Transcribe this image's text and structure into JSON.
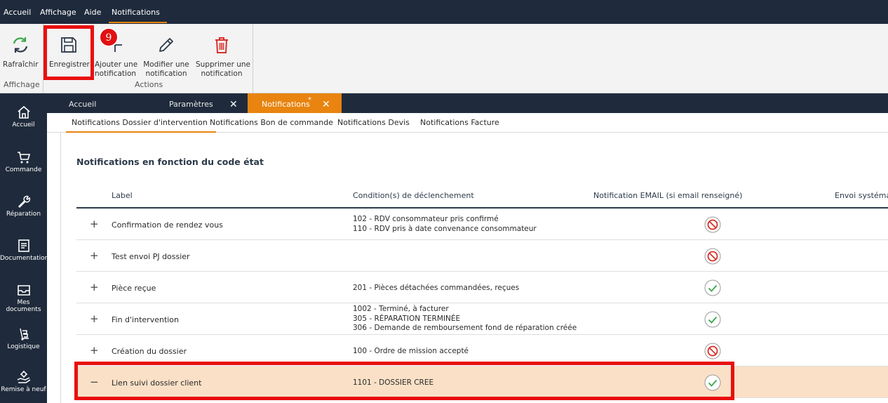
{
  "menu": {
    "items": [
      {
        "label": "Accueil"
      },
      {
        "label": "Affichage"
      },
      {
        "label": "Aide"
      },
      {
        "label": "Notifications"
      }
    ]
  },
  "ribbon": {
    "refresh": {
      "label": "Rafraîchir",
      "icon": "refresh-icon"
    },
    "save": {
      "label": "Enregistrer",
      "icon": "save-icon"
    },
    "add": {
      "line1": "Ajouter une",
      "line2": "notification",
      "icon": "plus-icon"
    },
    "edit": {
      "line1": "Modifier une",
      "line2": "notification",
      "icon": "pencil-icon"
    },
    "delete": {
      "line1": "Supprimer une",
      "line2": "notification",
      "icon": "trash-icon"
    },
    "groups": {
      "display": "Affichage",
      "actions": "Actions"
    },
    "step_badge": "9"
  },
  "sidebar": {
    "items": [
      {
        "label": "Accueil",
        "icon": "home-icon"
      },
      {
        "label": "Commande",
        "icon": "cart-icon"
      },
      {
        "label": "Réparation",
        "icon": "wrench-icon"
      },
      {
        "label": "Documentation",
        "icon": "document-icon"
      },
      {
        "label": "Mes documents",
        "icon": "inbox-icon"
      },
      {
        "label": "Logistique",
        "icon": "hand-truck-icon"
      },
      {
        "label": "Remise à neuf",
        "icon": "hand-gear-icon"
      }
    ]
  },
  "tabs": [
    {
      "label": "Accueil"
    },
    {
      "label": "Paramètres",
      "close": "✕"
    },
    {
      "label": "Notifications",
      "modified": "*",
      "close": "✕"
    }
  ],
  "subtabs": [
    {
      "label": "Notifications Dossier d'intervention"
    },
    {
      "label": "Notifications Bon de commande"
    },
    {
      "label": "Notifications Devis"
    },
    {
      "label": "Notifications Facture"
    }
  ],
  "content": {
    "title": "Notifications en fonction du code état",
    "columns": {
      "label": "Label",
      "conditions": "Condition(s) de déclenchement",
      "email": "Notification EMAIL (si email renseigné)",
      "envoi": "Envoi systémati"
    },
    "rows": [
      {
        "toggle": "+",
        "label": "Confirmation de rendez vous",
        "conditions": [
          "102 - RDV consommateur pris confirmé",
          "110 - RDV pris à date convenance consommateur"
        ],
        "email": "disabled"
      },
      {
        "toggle": "+",
        "label": "Test envoi PJ dossier",
        "conditions": [],
        "email": "disabled"
      },
      {
        "toggle": "+",
        "label": "Pièce reçue",
        "conditions": [
          "201 - Pièces détachées commandées, reçues"
        ],
        "email": "enabled"
      },
      {
        "toggle": "+",
        "label": "Fin d'intervention",
        "conditions": [
          "1002 - Terminé, à facturer",
          "305 - RÉPARATION TERMINÉE",
          "306 - Demande de remboursement fond de réparation créée"
        ],
        "email": "enabled"
      },
      {
        "toggle": "+",
        "label": "Création du dossier",
        "conditions": [
          "100 - Ordre de mission accepté"
        ],
        "email": "disabled"
      },
      {
        "toggle": "−",
        "label": "Lien suivi dossier client",
        "conditions": [
          "1101 - DOSSIER CREE"
        ],
        "email": "enabled",
        "selected": true
      }
    ]
  },
  "colors": {
    "dark_navy": "#1f2b3c",
    "accent_orange": "#e8840f",
    "highlight_red": "#e90f0f",
    "selected_row": "#fae0c6",
    "enabled_green": "#3aa84a",
    "disabled_red": "#d9302a"
  }
}
